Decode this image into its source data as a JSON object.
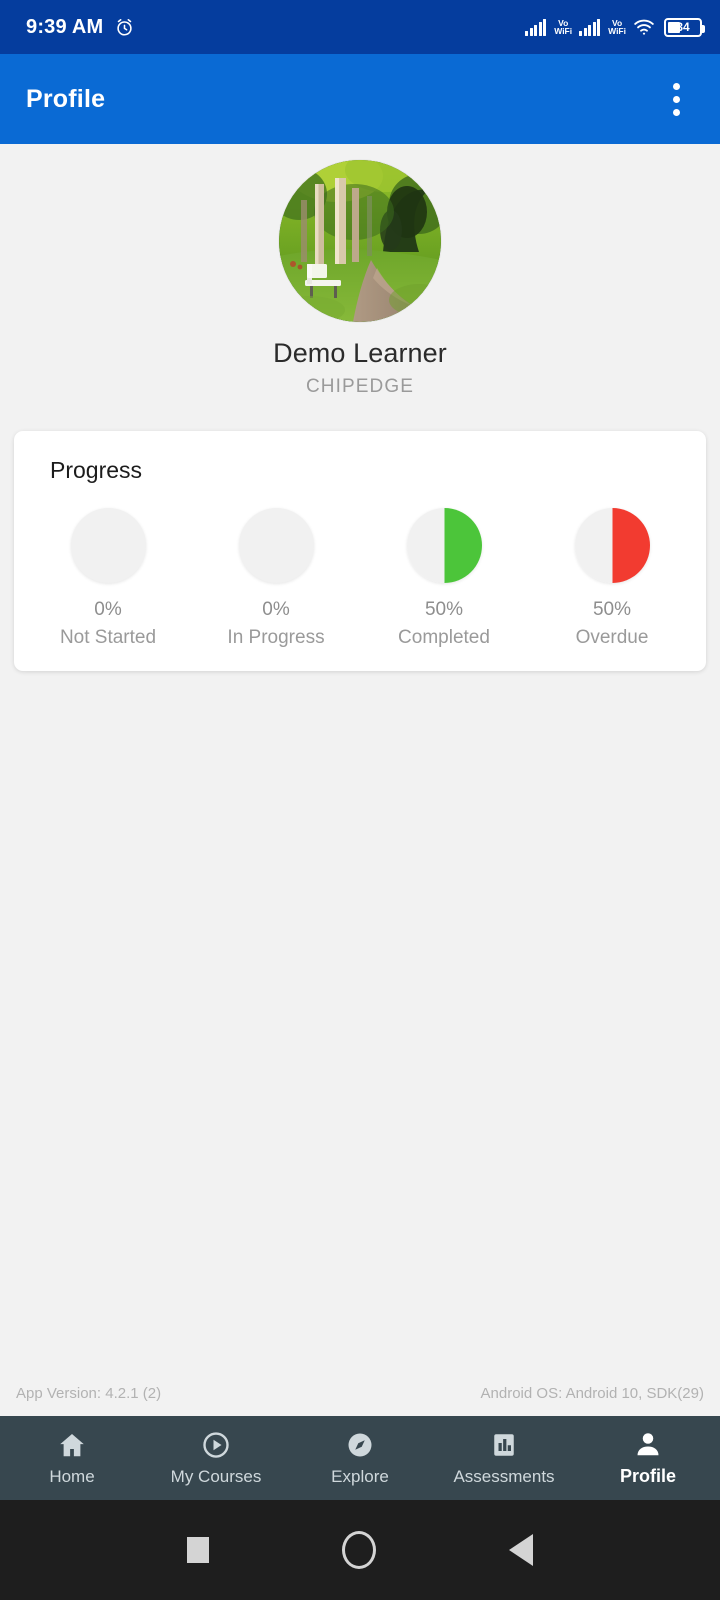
{
  "status_bar": {
    "time": "9:39 AM",
    "alarm_icon": "alarm-clock-icon",
    "sim1_label": "Vo\nWiFi",
    "sim1_line1": "Vo",
    "sim1_line2": "WiFi",
    "sim2_line1": "Vo",
    "sim2_line2": "WiFi",
    "wifi_icon": "wifi-icon",
    "battery_percent": "34",
    "background_color": "#053d9e"
  },
  "app_bar": {
    "title": "Profile",
    "overflow_icon": "more-vertical-icon",
    "background_color": "#0a6ad4"
  },
  "profile": {
    "avatar_icon": "user-avatar-photo",
    "name": "Demo Learner",
    "organization": "CHIPEDGE"
  },
  "progress_card": {
    "title": "Progress",
    "stats": [
      {
        "percent": "0%",
        "label": "Not Started",
        "value": 0,
        "color": "#f1f1f1"
      },
      {
        "percent": "0%",
        "label": "In Progress",
        "value": 0,
        "color": "#f1f1f1"
      },
      {
        "percent": "50%",
        "label": "Completed",
        "value": 50,
        "color": "#4cc53a"
      },
      {
        "percent": "50%",
        "label": "Overdue",
        "value": 50,
        "color": "#f23b30"
      }
    ]
  },
  "footer": {
    "app_version": "App Version:  4.2.1 (2)",
    "android_os": "Android OS:  Android 10,  SDK(29)"
  },
  "bottom_nav": {
    "items": [
      {
        "label": "Home",
        "icon": "home-icon",
        "active": false
      },
      {
        "label": "My Courses",
        "icon": "play-circle-icon",
        "active": false
      },
      {
        "label": "Explore",
        "icon": "compass-icon",
        "active": false
      },
      {
        "label": "Assessments",
        "icon": "bar-chart-icon",
        "active": false
      },
      {
        "label": "Profile",
        "icon": "person-icon",
        "active": true
      }
    ],
    "background_color": "#37474f"
  },
  "system_nav": {
    "recents_icon": "square-icon",
    "home_icon": "circle-icon",
    "back_icon": "triangle-back-icon"
  }
}
